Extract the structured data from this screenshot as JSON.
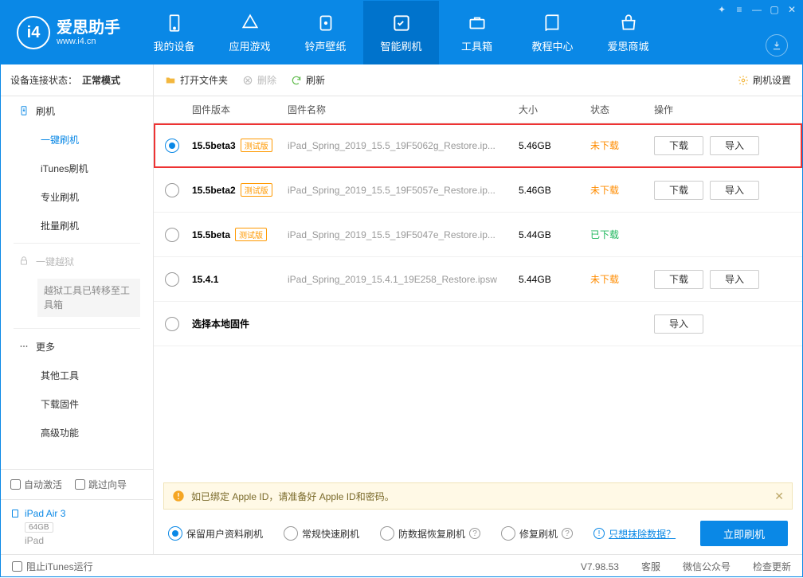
{
  "brand": {
    "cn": "爱思助手",
    "en": "www.i4.cn"
  },
  "nav": [
    "我的设备",
    "应用游戏",
    "铃声壁纸",
    "智能刷机",
    "工具箱",
    "教程中心",
    "爱思商城"
  ],
  "nav_active": 3,
  "connect": {
    "label": "设备连接状态：",
    "value": "正常模式"
  },
  "sidebar": {
    "flash": "刷机",
    "items": [
      "一键刷机",
      "iTunes刷机",
      "专业刷机",
      "批量刷机"
    ],
    "jailbreak": "一键越狱",
    "jb_note": "越狱工具已转移至工具箱",
    "more": "更多",
    "more_items": [
      "其他工具",
      "下载固件",
      "高级功能"
    ]
  },
  "auto": {
    "activate": "自动激活",
    "skip": "跳过向导"
  },
  "device": {
    "name": "iPad Air 3",
    "capacity": "64GB",
    "type": "iPad"
  },
  "toolbar": {
    "open": "打开文件夹",
    "delete": "删除",
    "refresh": "刷新",
    "settings": "刷机设置"
  },
  "cols": {
    "ver": "固件版本",
    "name": "固件名称",
    "size": "大小",
    "status": "状态",
    "ops": "操作"
  },
  "rows": [
    {
      "sel": true,
      "ver": "15.5beta3",
      "beta": true,
      "name": "iPad_Spring_2019_15.5_19F5062g_Restore.ip...",
      "size": "5.46GB",
      "status": "未下载",
      "dl": true,
      "imp": true
    },
    {
      "sel": false,
      "ver": "15.5beta2",
      "beta": true,
      "name": "iPad_Spring_2019_15.5_19F5057e_Restore.ip...",
      "size": "5.46GB",
      "status": "未下载",
      "dl": true,
      "imp": true
    },
    {
      "sel": false,
      "ver": "15.5beta",
      "beta": true,
      "name": "iPad_Spring_2019_15.5_19F5047e_Restore.ip...",
      "size": "5.44GB",
      "status": "已下载",
      "dl": false,
      "imp": false
    },
    {
      "sel": false,
      "ver": "15.4.1",
      "beta": false,
      "name": "iPad_Spring_2019_15.4.1_19E258_Restore.ipsw",
      "size": "5.44GB",
      "status": "未下载",
      "dl": true,
      "imp": true
    },
    {
      "sel": false,
      "ver": "选择本地固件",
      "beta": false,
      "name": "",
      "size": "",
      "status": "",
      "dl": false,
      "imp": true
    }
  ],
  "beta_tag": "测试版",
  "ops": {
    "download": "下载",
    "import": "导入"
  },
  "warn": "如已绑定 Apple ID，请准备好 Apple ID和密码。",
  "flash": {
    "opt1": "保留用户资料刷机",
    "opt2": "常规快速刷机",
    "opt3": "防数据恢复刷机",
    "opt4": "修复刷机",
    "link": "只想抹除数据？",
    "button": "立即刷机"
  },
  "status": {
    "block": "阻止iTunes运行",
    "version": "V7.98.53",
    "cs": "客服",
    "wechat": "微信公众号",
    "check": "检查更新"
  }
}
